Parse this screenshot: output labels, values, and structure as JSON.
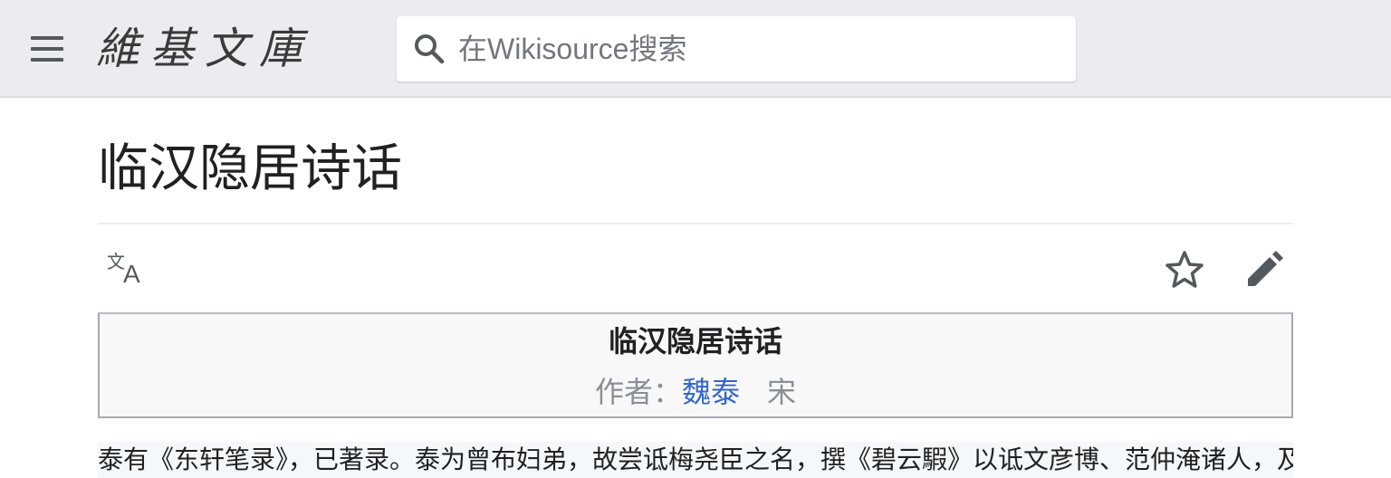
{
  "header": {
    "site_wordmark": "維基文庫",
    "search": {
      "placeholder": "在Wikisource搜索",
      "value": ""
    }
  },
  "page": {
    "title": "临汉隐居诗话"
  },
  "toolbar": {
    "icons": [
      "language-icon",
      "star-icon",
      "pencil-icon"
    ]
  },
  "work_header": {
    "title": "临汉隐居诗话",
    "author_prefix": "作者：",
    "author_name": "魏泰",
    "dynasty": "宋"
  },
  "content": {
    "first_line": "泰有《东轩笔录》，已著录。泰为曾布妇弟，故尝诋梅尧臣之名，撰《碧云騢》以诋文彦博、范仲淹诸人，及作此"
  },
  "colors": {
    "header_bg": "#eaecf0",
    "link": "#3366cc",
    "text": "#202122",
    "muted": "#8a8f96"
  }
}
